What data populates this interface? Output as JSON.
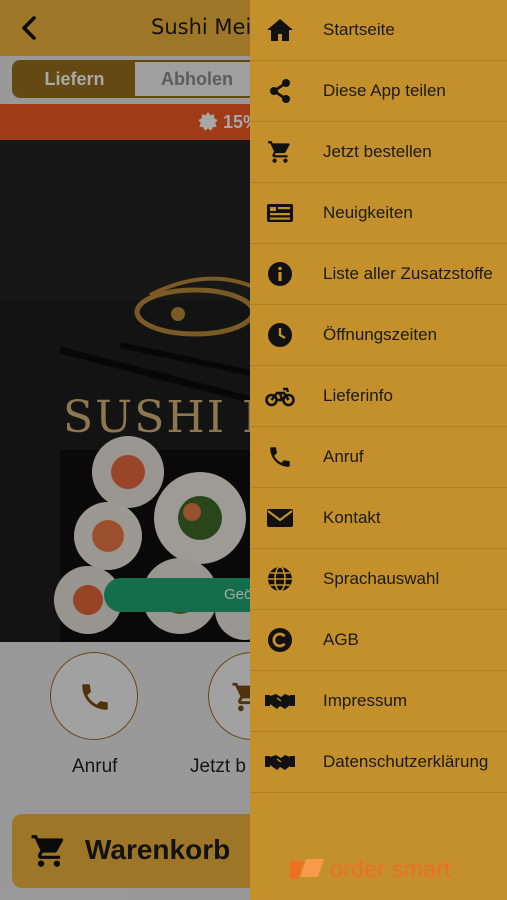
{
  "header": {
    "title": "Sushi Meist",
    "back_icon": "chevron-left-icon"
  },
  "order_mode": {
    "deliver_label": "Liefern",
    "pickup_label": "Abholen",
    "selected": "Liefern"
  },
  "promo": {
    "text": "15%",
    "color": "#f15a22"
  },
  "hero": {
    "brand_text": "SUSHI M",
    "geo_button_label": "Geö"
  },
  "actions": [
    {
      "label": "Anruf",
      "icon": "phone-icon"
    },
    {
      "label": "Jetzt b",
      "icon": "cart-icon"
    }
  ],
  "cart": {
    "label": "Warenkorb",
    "icon": "cart-icon"
  },
  "drawer": {
    "items": [
      {
        "label": "Startseite",
        "icon": "home-icon"
      },
      {
        "label": "Diese App teilen",
        "icon": "share-icon"
      },
      {
        "label": "Jetzt bestellen",
        "icon": "cart-icon"
      },
      {
        "label": "Neuigkeiten",
        "icon": "news-icon"
      },
      {
        "label": "Liste aller Zusatzstoffe",
        "icon": "info-icon"
      },
      {
        "label": "Öffnungszeiten",
        "icon": "clock-icon"
      },
      {
        "label": "Lieferinfo",
        "icon": "motorbike-icon"
      },
      {
        "label": "Anruf",
        "icon": "phone-icon"
      },
      {
        "label": "Kontakt",
        "icon": "envelope-icon"
      },
      {
        "label": "Sprachauswahl",
        "icon": "globe-icon"
      },
      {
        "label": "AGB",
        "icon": "copyright-icon"
      },
      {
        "label": "Impressum",
        "icon": "handshake-icon"
      },
      {
        "label": "Datenschutzerklärung",
        "icon": "handshake-icon"
      }
    ],
    "brand": "order smart"
  },
  "colors": {
    "accent": "#f0b33c",
    "drawer": "#c4902c",
    "brown": "#9a6f1d",
    "geo_green": "#1fa776"
  }
}
